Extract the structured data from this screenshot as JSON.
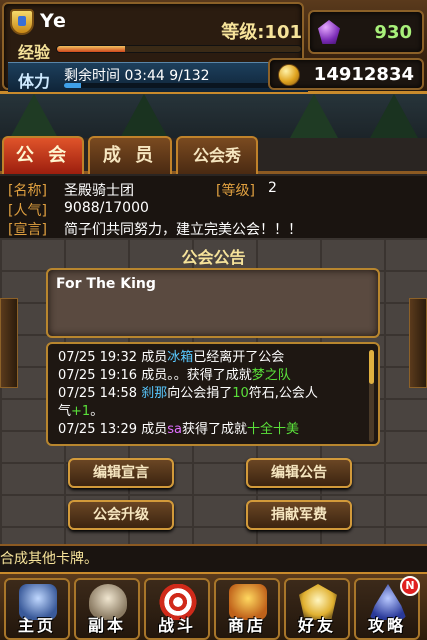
{
  "player": {
    "name": "Ye",
    "level_text": "等级:101",
    "exp_label": "经验",
    "exp_fraction": 0.28,
    "stamina_label": "体力",
    "stamina_timer_text": "剩余时间  03:44   9/132",
    "stamina_fraction": 0.07
  },
  "currency": {
    "gems": "930",
    "gold": "14912834"
  },
  "tabs": [
    {
      "label": "公 会",
      "active": true
    },
    {
      "label": "成 员",
      "active": false
    },
    {
      "label": "公会秀",
      "active": false
    }
  ],
  "guild": {
    "name_label": "[名称]",
    "name": "圣殿骑士团",
    "level_label": "[等级]",
    "level": "2",
    "popularity_label": "[人气]",
    "popularity": "9088/17000",
    "declaration_label": "[宣言]",
    "declaration": "简子们共同努力，建立完美公会！！！"
  },
  "notice": {
    "title": "公会公告",
    "text": "For The King"
  },
  "log": [
    {
      "time": "07/25 19:32 ",
      "pre": "成员",
      "highlight": "冰箱",
      "highlight_color": "cyan",
      "post": "已经离开了公会"
    },
    {
      "time": "07/25 19:16 ",
      "pre": "成员。。获得了成就",
      "highlight": "梦之队",
      "highlight_color": "green",
      "post": ""
    },
    {
      "time": "07/25 14:58 ",
      "pre": "",
      "highlight": "刹那",
      "highlight_color": "cyan",
      "post": "向公会捐了",
      "highlight2": "10",
      "highlight2_color": "green",
      "post2": "符石,公会人"
    },
    {
      "time": "",
      "pre": "气",
      "highlight": "+1",
      "highlight_color": "green",
      "post": "。"
    },
    {
      "time": "07/25 13:29 ",
      "pre": "成员",
      "highlight": "sa",
      "highlight_color": "purple",
      "post": "获得了成就",
      "highlight2": "十全十美",
      "highlight2_color": "green",
      "post2": ""
    }
  ],
  "buttons": {
    "edit_declaration": "编辑宣言",
    "edit_notice": "编辑公告",
    "upgrade_guild": "公会升级",
    "donate_funds": "捐献军费"
  },
  "ticker": "合成其他卡牌。",
  "nav": [
    {
      "label": "主页",
      "icon": "home-icon"
    },
    {
      "label": "副本",
      "icon": "skull-icon"
    },
    {
      "label": "战斗",
      "icon": "target-icon"
    },
    {
      "label": "商店",
      "icon": "merchant-icon"
    },
    {
      "label": "好友",
      "icon": "wings-icon"
    },
    {
      "label": "攻略",
      "icon": "wizard-hat-icon"
    }
  ],
  "guide_badge": "N"
}
